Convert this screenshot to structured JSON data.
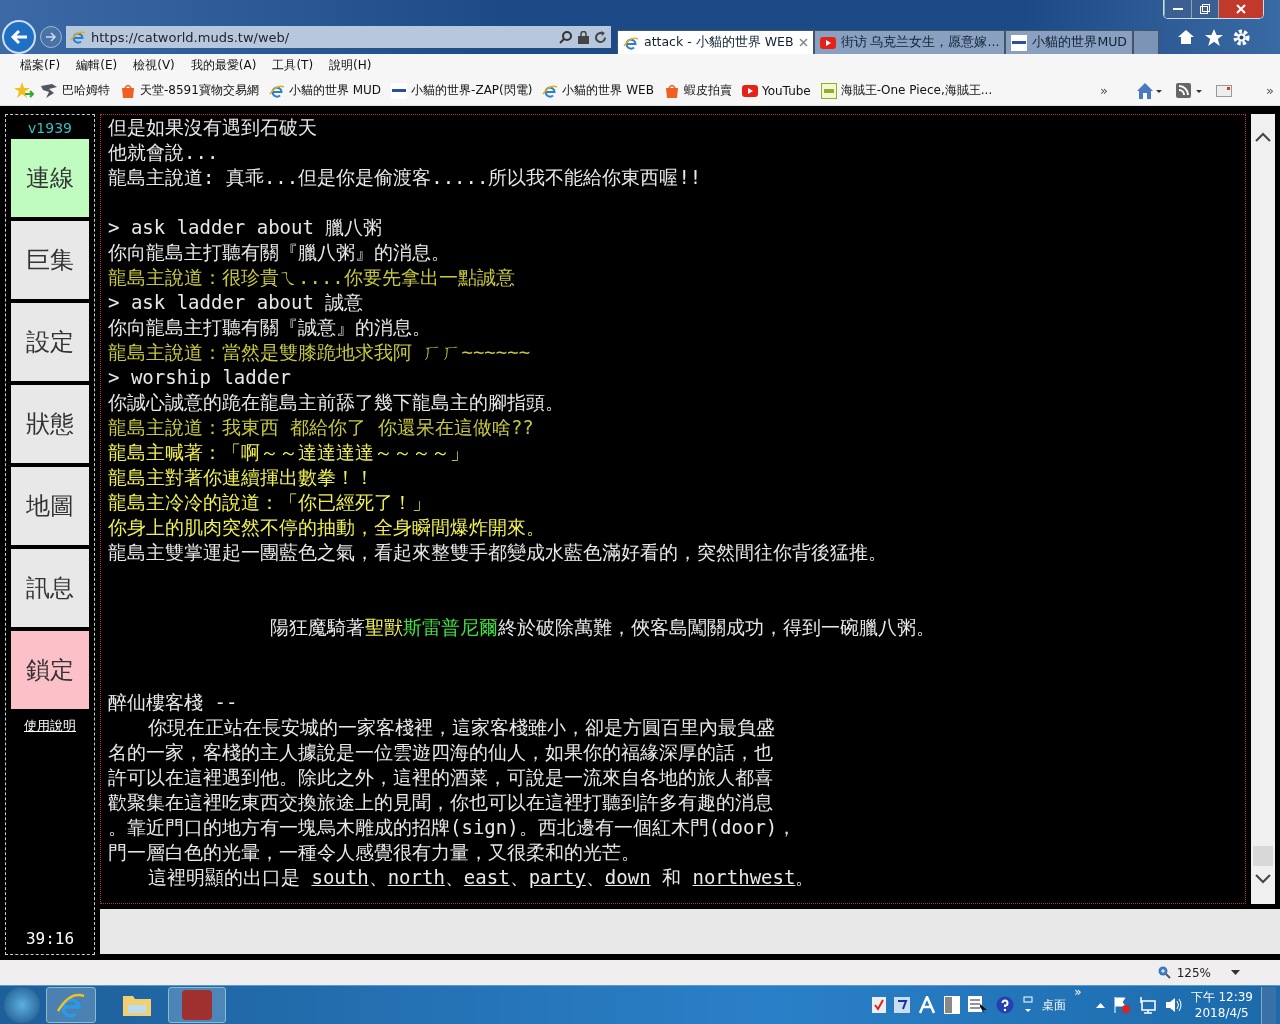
{
  "browser": {
    "address": "https://catworld.muds.tw/web/",
    "tabs": [
      {
        "title": "attack - 小貓的世界 WEB",
        "selected": true
      },
      {
        "title": "街访 乌克兰女生，愿意嫁...",
        "selected": false
      },
      {
        "title": "小貓的世界MUD",
        "selected": false
      }
    ],
    "menu": [
      "檔案(F)",
      "編輯(E)",
      "檢視(V)",
      "我的最愛(A)",
      "工具(T)",
      "說明(H)"
    ],
    "favorites": [
      "巴哈姆特",
      "天堂-8591寶物交易網",
      "小貓的世界 MUD",
      "小貓的世界-ZAP(閃電)",
      "小貓的世界 WEB",
      "蝦皮拍賣",
      "YouTube",
      "海賊王-One Piece,海賊王..."
    ],
    "more": "»",
    "tools_more": "»"
  },
  "sidebar": {
    "version": "v1939",
    "buttons": [
      {
        "label": "連線",
        "color": "#c0fcc0"
      },
      {
        "label": "巨集",
        "color": "#e8e8e8"
      },
      {
        "label": "設定",
        "color": "#e8e8e8"
      },
      {
        "label": "狀態",
        "color": "#e8e8e8"
      },
      {
        "label": "地圖",
        "color": "#e8e8e8"
      },
      {
        "label": "訊息",
        "color": "#e8e8e8"
      },
      {
        "label": "鎖定",
        "color": "#fcc0c8"
      }
    ],
    "help": "使用說明",
    "timer": "39:16"
  },
  "output": {
    "lines": [
      {
        "kind": "text",
        "text": "但是如果沒有遇到石破天",
        "color": "#e8e8e8"
      },
      {
        "kind": "text",
        "text": "他就會說...",
        "color": "#e8e8e8"
      },
      {
        "kind": "text",
        "text": "龍島主說道: 真乖...但是你是偷渡客.....所以我不能給你東西喔!!",
        "color": "#e8e8e8"
      },
      {
        "kind": "gap"
      },
      {
        "kind": "command",
        "text": "> ask ladder about 臘八粥",
        "color": "#e8e8e8"
      },
      {
        "kind": "text",
        "text": "你向龍島主打聽有關『臘八粥』的消息。",
        "color": "#e8e8e8"
      },
      {
        "kind": "text",
        "text": "龍島主說道：很珍貴ㄟ....你要先拿出一點誠意",
        "color": "#c8c83c"
      },
      {
        "kind": "command",
        "text": "> ask ladder about 誠意",
        "color": "#e8e8e8"
      },
      {
        "kind": "text",
        "text": "你向龍島主打聽有關『誠意』的消息。",
        "color": "#e8e8e8"
      },
      {
        "kind": "text",
        "text": "龍島主說道：當然是雙膝跪地求我阿 ㄏㄏ~~~~~~",
        "color": "#c8c83c"
      },
      {
        "kind": "command",
        "text": "> worship ladder",
        "color": "#e8e8e8"
      },
      {
        "kind": "text",
        "text": "你誠心誠意的跪在龍島主前舔了幾下龍島主的腳指頭。",
        "color": "#e8e8e8"
      },
      {
        "kind": "text",
        "text": "龍島主說道：我東西 都給你了 你還呆在這做啥??",
        "color": "#c8c83c"
      },
      {
        "kind": "text",
        "text": "龍島主喊著：「啊～～達達達達～～～～」",
        "color": "#f0f050"
      },
      {
        "kind": "text",
        "text": "龍島主對著你連續揮出數拳！！",
        "color": "#f0f050"
      },
      {
        "kind": "text",
        "text": "龍島主冷冷的說道：「你已經死了！」",
        "color": "#f0f050"
      },
      {
        "kind": "text",
        "text": "你身上的肌肉突然不停的抽動，全身瞬間爆炸開來。",
        "color": "#f0f050"
      },
      {
        "kind": "text",
        "text": "龍島主雙掌運起一團藍色之氣，看起來整雙手都變成水藍色滿好看的，突然間往你背後猛推。",
        "color": "#e8e8e8"
      },
      {
        "kind": "gap"
      },
      {
        "kind": "gap"
      },
      {
        "kind": "announce",
        "color": "#e8e8e8",
        "segments": [
          {
            "text": "陽狂魔騎著"
          },
          {
            "text": "聖獸",
            "color": "#f0f050"
          },
          {
            "text": "斯雷普尼爾",
            "color": "#40e040"
          },
          {
            "text": "終於破除萬難，俠客島闖關成功，得到一碗臘八粥。"
          }
        ]
      },
      {
        "kind": "gap"
      },
      {
        "kind": "gap"
      },
      {
        "kind": "text",
        "text": "醉仙樓客棧 --",
        "color": "#e8e8e8"
      },
      {
        "kind": "indented",
        "text": "你現在正站在長安城的一家客棧裡，這家客棧雖小，卻是方圓百里內最負盛",
        "color": "#e8e8e8"
      },
      {
        "kind": "text",
        "text": "名的一家，客棧的主人據說是一位雲遊四海的仙人，如果你的福緣深厚的話，也",
        "color": "#e8e8e8"
      },
      {
        "kind": "text",
        "text": "許可以在這裡遇到他。除此之外，這裡的酒菜，可說是一流來自各地的旅人都喜",
        "color": "#e8e8e8"
      },
      {
        "kind": "text",
        "text": "歡聚集在這裡吃東西交換旅途上的見聞，你也可以在這裡打聽到許多有趣的消息",
        "color": "#e8e8e8"
      },
      {
        "kind": "text",
        "text": "。靠近門口的地方有一塊烏木雕成的招牌(sign)。西北邊有一個紅木門(door)，",
        "color": "#e8e8e8"
      },
      {
        "kind": "text",
        "text": "門一層白色的光暈，一種令人感覺很有力量，又很柔和的光芒。",
        "color": "#e8e8e8"
      },
      {
        "kind": "indented",
        "color": "#e8e8e8",
        "segments": [
          {
            "text": "這裡明顯的出口是 ",
            "link": false
          },
          {
            "text": "south",
            "link": true
          },
          {
            "text": "、",
            "link": false
          },
          {
            "text": "north",
            "link": true
          },
          {
            "text": "、",
            "link": false
          },
          {
            "text": "east",
            "link": true
          },
          {
            "text": "、",
            "link": false
          },
          {
            "text": "party",
            "link": true
          },
          {
            "text": "、",
            "link": false
          },
          {
            "text": "down",
            "link": true
          },
          {
            "text": " 和 ",
            "link": false
          },
          {
            "text": "northwest",
            "link": true
          },
          {
            "text": "。",
            "link": false
          }
        ]
      }
    ]
  },
  "status_bar": {
    "zoom": "125%"
  },
  "taskbar": {
    "desktop": "桌面",
    "more": "»",
    "time": "下午 12:39",
    "date": "2018/4/5"
  }
}
